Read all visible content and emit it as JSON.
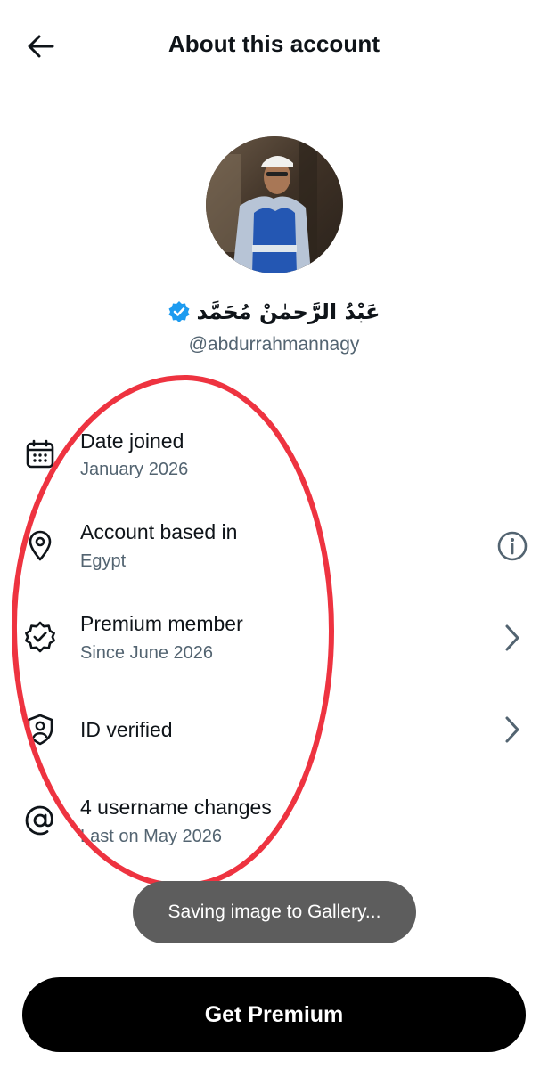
{
  "header": {
    "title": "About this account",
    "back_icon": "arrow-left-icon"
  },
  "profile": {
    "display_name": "عَبْدُ الرَّحمٰنْ مُحَمَّد",
    "handle": "@abdurrahmannagy",
    "verified": true,
    "verified_color": "#1d9bf0"
  },
  "info": {
    "date_joined": {
      "title": "Date joined",
      "subtitle": "January 2026",
      "icon": "calendar-icon"
    },
    "account_based": {
      "title": "Account based in",
      "subtitle": "Egypt",
      "icon": "location-pin-icon",
      "action_icon": "info-icon"
    },
    "premium": {
      "title": "Premium member",
      "subtitle": "Since June 2026",
      "icon": "verified-badge-outline-icon",
      "action_icon": "chevron-right-icon"
    },
    "id_verified": {
      "title": "ID verified",
      "icon": "id-shield-icon",
      "action_icon": "chevron-right-icon"
    },
    "username_changes": {
      "title": "4 username changes",
      "subtitle": "Last on May 2026",
      "icon": "at-sign-icon"
    }
  },
  "toast": {
    "text": "Saving image to Gallery..."
  },
  "cta": {
    "label": "Get Premium"
  },
  "colors": {
    "text_primary": "#0f1419",
    "text_secondary": "#536471",
    "annotation_red": "#ee3340",
    "toast_bg": "#5d5d5d",
    "cta_bg": "#000000"
  }
}
